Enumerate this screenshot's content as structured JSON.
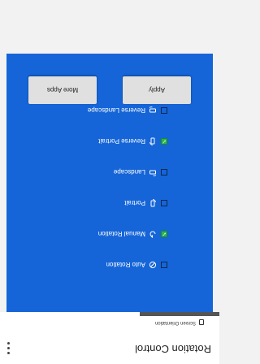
{
  "app_bar": {
    "title": "Rotation Control",
    "menu_icon": "more-vertical-icon"
  },
  "tabs": [
    {
      "label": "Screen Orientation",
      "icon": "phone-icon",
      "selected": true
    }
  ],
  "options": [
    {
      "label": "Auto Rotation",
      "checked": false,
      "icon": "auto-rotate-icon"
    },
    {
      "label": "Manual Rotation",
      "checked": true,
      "icon": "manual-rotate-icon"
    },
    {
      "label": "Portrait",
      "checked": false,
      "icon": "portrait-icon"
    },
    {
      "label": "Landscape",
      "checked": false,
      "icon": "landscape-icon"
    },
    {
      "label": "Reverse Portrait",
      "checked": true,
      "icon": "reverse-portrait-icon"
    },
    {
      "label": "Reverse Landscape",
      "checked": false,
      "icon": "reverse-landscape-icon"
    }
  ],
  "buttons": {
    "apply": "Apply",
    "more_apps": "More Apps"
  },
  "colors": {
    "panel_blue": "#1565d8",
    "check_green": "#2db54a"
  }
}
